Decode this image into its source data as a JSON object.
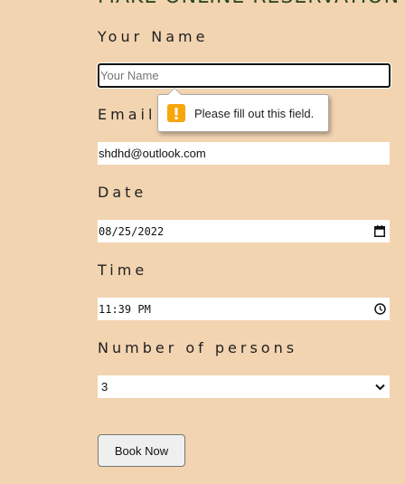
{
  "page_heading": "MAKE ONLINE RESERVATION",
  "form": {
    "name": {
      "label": "Your Name",
      "placeholder": "Your Name",
      "value": ""
    },
    "email": {
      "label": "Email",
      "value": "shdhd@outlook.com"
    },
    "date": {
      "label": "Date",
      "value": "08/25/2022"
    },
    "time": {
      "label": "Time",
      "value": "11:39 PM"
    },
    "persons": {
      "label": "Number of persons",
      "selected": "3"
    },
    "submit_label": "Book Now"
  },
  "validation_tooltip": {
    "message": "Please fill out this field.",
    "icon": "warning-icon",
    "icon_symbol": "!",
    "icon_color": "#f6a608"
  },
  "colors": {
    "background": "#f2d4b1",
    "heading": "#2d4a22"
  }
}
